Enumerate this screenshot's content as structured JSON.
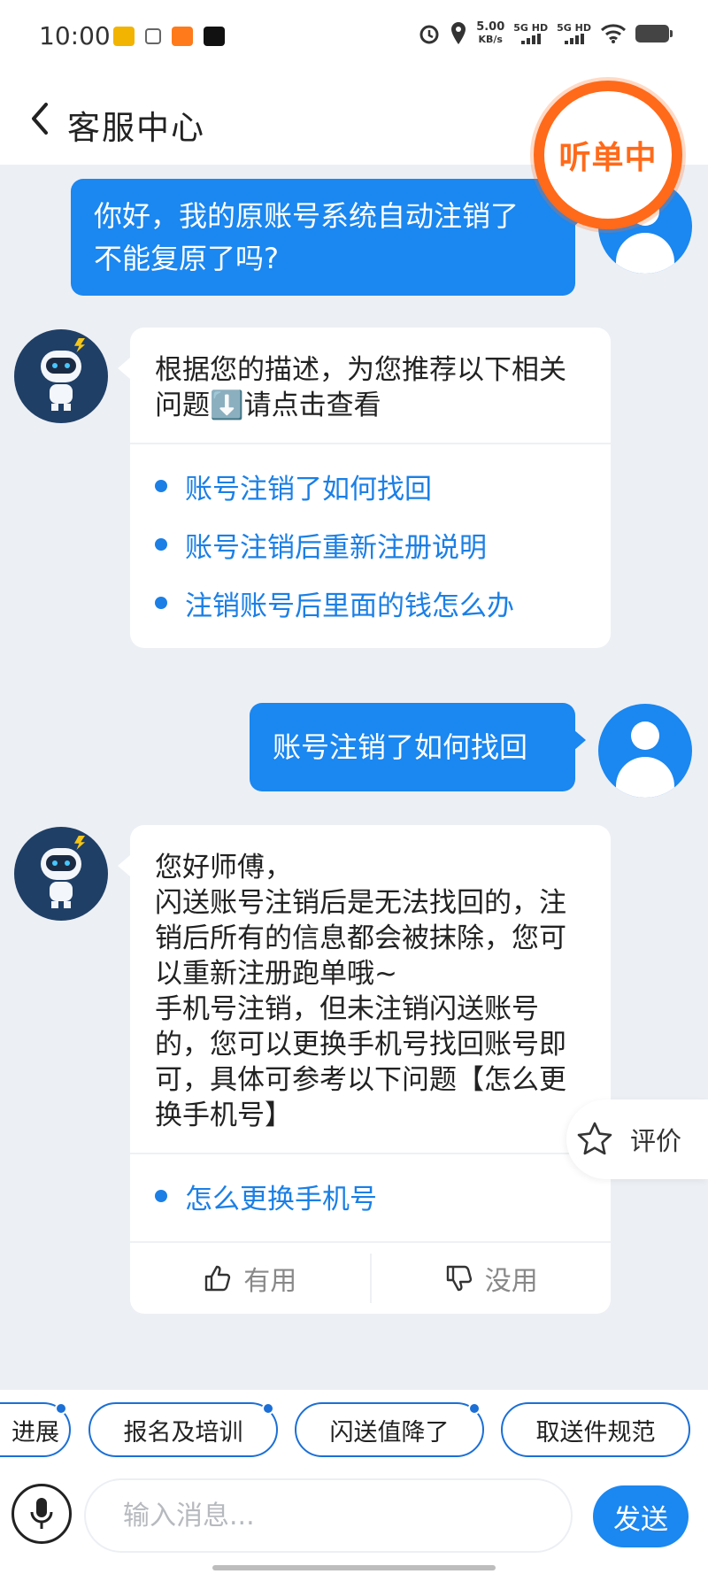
{
  "status_bar": {
    "time": "10:00",
    "net_speed_value": "5.00",
    "net_speed_unit": "KB/s",
    "signal_1": "5G HD",
    "signal_2": "5G HD"
  },
  "header": {
    "title": "客服中心",
    "listening_badge": "听单中"
  },
  "messages": [
    {
      "role": "user",
      "text": "你好，我的原账号系统自动注销了 不能复原了吗?"
    },
    {
      "role": "bot",
      "text": "根据您的描述，为您推荐以下相关问题⬇️请点击查看",
      "links": [
        "账号注销了如何找回",
        "账号注销后重新注册说明",
        "注销账号后里面的钱怎么办"
      ]
    },
    {
      "role": "user",
      "text": "账号注销了如何找回"
    },
    {
      "role": "bot",
      "text": "您好师傅，\n闪送账号注销后是无法找回的，注销后所有的信息都会被抹除，您可以重新注册跑单哦~\n手机号注销，但未注销闪送账号的，您可以更换手机号找回账号即可，具体可参考以下问题【怎么更换手机号】",
      "links": [
        "怎么更换手机号"
      ],
      "feedback": {
        "useful": "有用",
        "useless": "没用"
      }
    }
  ],
  "rate_button": "评价",
  "quick_chips": [
    "进展",
    "报名及培训",
    "闪送值降了",
    "取送件规范"
  ],
  "input": {
    "placeholder": "输入消息...",
    "value": ""
  },
  "send_button": "发送",
  "colors": {
    "primary": "#1b87f0",
    "link": "#1b7fe6",
    "badge_orange": "#ff6a1a",
    "background": "#eceff4"
  }
}
